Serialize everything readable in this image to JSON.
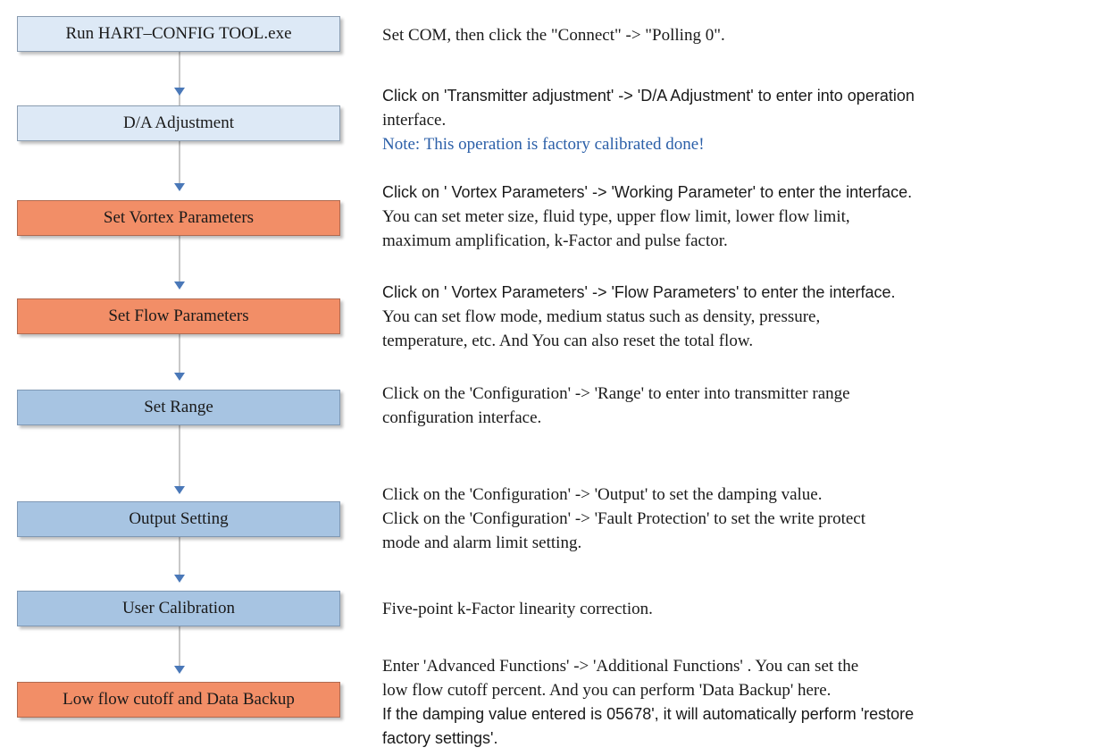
{
  "steps": [
    {
      "label": "Run HART–CONFIG TOOL.exe",
      "color": "#dde9f6",
      "lines": [
        "Set COM, then click the \"Connect\" -> \"Polling 0\"."
      ]
    },
    {
      "label": "D/A Adjustment",
      "color": "#dde9f6",
      "lines": [
        "Click on 'Transmitter adjustment' -> 'D/A Adjustment' to enter into operation",
        "interface."
      ],
      "note": "Note: This operation is factory calibrated done!",
      "note_color": "#2b5fa8"
    },
    {
      "label": "Set Vortex Parameters",
      "color": "#f28e67",
      "lines": [
        "Click on ' Vortex Parameters' -> 'Working Parameter' to enter the interface.",
        "You can set  meter size, fluid type, upper flow limit, lower flow limit,",
        "maximum amplification, k-Factor and pulse factor."
      ]
    },
    {
      "label": "Set Flow Parameters",
      "color": "#f28e67",
      "lines": [
        "Click on ' Vortex Parameters' -> 'Flow Parameters' to enter the interface.",
        "You can set  flow mode, medium status such as density, pressure,",
        "temperature, etc.  And You can also reset the total flow."
      ]
    },
    {
      "label": "Set Range",
      "color": "#a7c4e2",
      "lines": [
        "Click on the 'Configuration' -> 'Range' to enter into transmitter range",
        "configuration interface."
      ]
    },
    {
      "label": "Output Setting",
      "color": "#a7c4e2",
      "lines": [
        "Click on the 'Configuration' -> 'Output' to set the damping value.",
        "Click on the 'Configuration' -> 'Fault Protection' to set the write protect",
        "mode and alarm limit setting."
      ]
    },
    {
      "label": "User Calibration",
      "color": "#a7c4e2",
      "lines": [
        "Five-point k-Factor linearity correction."
      ]
    },
    {
      "label": "Low flow cutoff and Data Backup",
      "color": "#f28e67",
      "lines": [
        "Enter 'Advanced Functions'  -> 'Additional Functions'  . You can set the",
        "low flow cutoff percent. And you can perform 'Data Backup' here.",
        "If the damping value entered is 05678', it will automatically perform 'restore",
        "factory settings'."
      ]
    }
  ]
}
